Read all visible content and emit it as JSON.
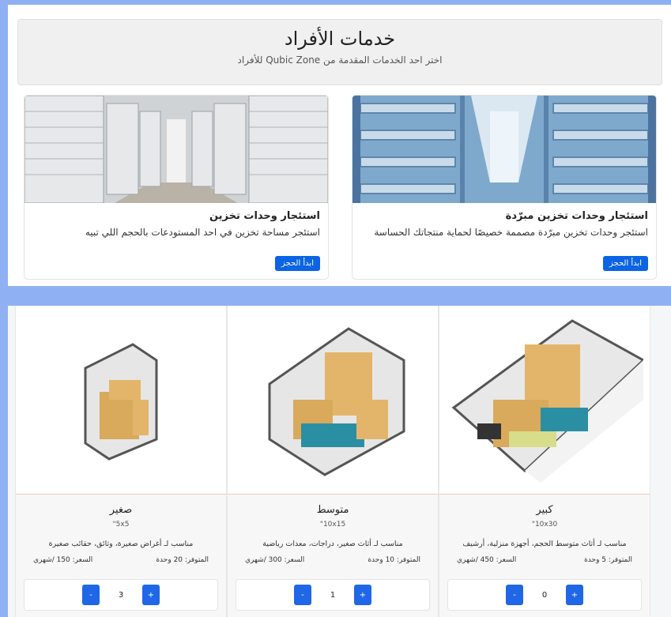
{
  "header": {
    "title": "خدمات الأفراد",
    "subtitle": "اختر احد الخدمات المقدمة من Qubic Zone للأفراد"
  },
  "cards": [
    {
      "title": "استئجار وحدات تخزين مبرّدة",
      "description": "استئجر وحدات تخزين مبرّدة مصممة خصيصًا لحماية منتجاتك الحساسة",
      "button": "ابدأ الحجز"
    },
    {
      "title": "استئجار وحدات تخزين",
      "description": "استئجر مساحة تخزين في احد المستودعات بالحجم اللي تبيه",
      "button": "ابدأ الحجز"
    }
  ],
  "units": [
    {
      "name": "كبير",
      "dims": "10x30\"",
      "desc": "مناسب لـ أثاث متوسط الحجم، أجهزة منزلية، أرشيف",
      "available": "المتوفر: 5 وحدة",
      "price": "السعر: 450 /شهري",
      "minus": "-",
      "plus": "+",
      "qty": "0"
    },
    {
      "name": "متوسط",
      "dims": "10x15\"",
      "desc": "مناسب لـ أثاث صغير، دراجات، معدات رياضية",
      "available": "المتوفر: 10 وحدة",
      "price": "السعر: 300 /شهري",
      "minus": "-",
      "plus": "+",
      "qty": "1"
    },
    {
      "name": "صغير",
      "dims": "5x5\"",
      "desc": "مناسب لـ أغراض صغيرة، وثائق، حقائب صغيرة",
      "available": "المتوفر: 20 وحدة",
      "price": "السعر: 150 /شهري",
      "minus": "-",
      "plus": "+",
      "qty": "3"
    }
  ],
  "colors": {
    "accent": "#0b63e5",
    "page_bg": "#8fb0f3"
  }
}
